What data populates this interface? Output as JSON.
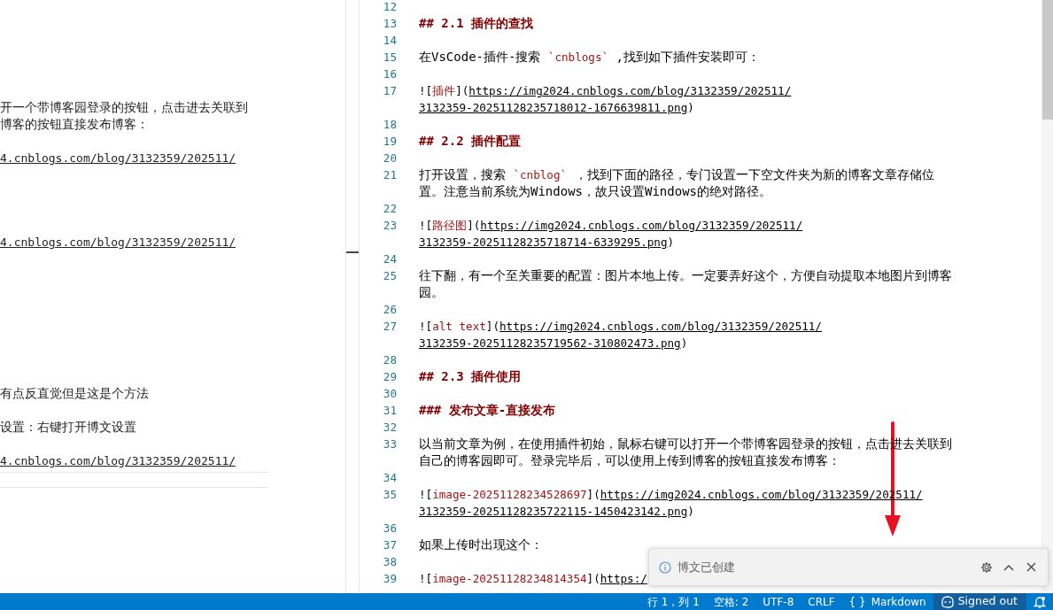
{
  "preview": {
    "blocks": [
      {
        "kind": "text",
        "lines": [
          "开一个带博客园登录的按钮，点击进去关联到",
          "博客的按钮直接发布博客："
        ]
      },
      {
        "kind": "link",
        "lines": [
          "4.cnblogs.com/blog/3132359/202511/"
        ]
      },
      {
        "kind": "link",
        "lines": [
          "4.cnblogs.com/blog/3132359/202511/"
        ]
      },
      {
        "kind": "text",
        "lines": [
          "有点反直觉但是这是个方法"
        ]
      },
      {
        "kind": "text",
        "lines": [
          "设置：右键打开博文设置"
        ]
      },
      {
        "kind": "link",
        "lines": [
          "4.cnblogs.com/blog/3132359/202511/"
        ]
      }
    ]
  },
  "editor": {
    "lines": [
      {
        "number": "12"
      },
      {
        "number": "13",
        "parts": [
          {
            "kind": "heading",
            "text": "## 2.1 插件的查找"
          }
        ]
      },
      {
        "number": "14"
      },
      {
        "number": "15",
        "parts": [
          {
            "kind": "text",
            "text": "在VsCode-插件-搜索 "
          },
          {
            "kind": "code",
            "text": "`cnblogs`"
          },
          {
            "kind": "text",
            "text": " ,找到如下插件安装即可："
          }
        ]
      },
      {
        "number": "16"
      },
      {
        "number": "17",
        "parts": [
          {
            "kind": "punct",
            "text": "!["
          },
          {
            "kind": "alt",
            "text": "插件"
          },
          {
            "kind": "punct",
            "text": "]("
          },
          {
            "kind": "url",
            "text": "https://img2024.cnblogs.com/blog/3132359/202511/"
          }
        ]
      },
      {
        "parts": [
          {
            "kind": "url",
            "text": "3132359-20251128235718012-1676639811.png"
          },
          {
            "kind": "punct",
            "text": ")"
          }
        ]
      },
      {
        "number": "18"
      },
      {
        "number": "19",
        "parts": [
          {
            "kind": "heading",
            "text": "## 2.2 插件配置"
          }
        ]
      },
      {
        "number": "20"
      },
      {
        "number": "21",
        "parts": [
          {
            "kind": "text",
            "text": "打开设置，搜索 "
          },
          {
            "kind": "code",
            "text": "`cnblog`"
          },
          {
            "kind": "text",
            "text": " ，找到下面的路径，专门设置一下空文件夹为新的博客文章存储位"
          }
        ]
      },
      {
        "parts": [
          {
            "kind": "text",
            "text": "置。注意当前系统为Windows，故只设置Windows的绝对路径。"
          }
        ]
      },
      {
        "number": "22"
      },
      {
        "number": "23",
        "parts": [
          {
            "kind": "punct",
            "text": "!["
          },
          {
            "kind": "alt",
            "text": "路径图"
          },
          {
            "kind": "punct",
            "text": "]("
          },
          {
            "kind": "url",
            "text": "https://img2024.cnblogs.com/blog/3132359/202511/"
          }
        ]
      },
      {
        "parts": [
          {
            "kind": "url",
            "text": "3132359-20251128235718714-6339295.png"
          },
          {
            "kind": "punct",
            "text": ")"
          }
        ]
      },
      {
        "number": "24"
      },
      {
        "number": "25",
        "parts": [
          {
            "kind": "text",
            "text": "往下翻，有一个至关重要的配置：图片本地上传。一定要弄好这个，方便自动提取本地图片到博客"
          }
        ]
      },
      {
        "parts": [
          {
            "kind": "text",
            "text": "园。"
          }
        ]
      },
      {
        "number": "26"
      },
      {
        "number": "27",
        "parts": [
          {
            "kind": "punct",
            "text": "!["
          },
          {
            "kind": "alt",
            "text": "alt text"
          },
          {
            "kind": "punct",
            "text": "]("
          },
          {
            "kind": "url",
            "text": "https://img2024.cnblogs.com/blog/3132359/202511/"
          }
        ]
      },
      {
        "parts": [
          {
            "kind": "url",
            "text": "3132359-20251128235719562-310802473.png"
          },
          {
            "kind": "punct",
            "text": ")"
          }
        ]
      },
      {
        "number": "28"
      },
      {
        "number": "29",
        "parts": [
          {
            "kind": "heading",
            "text": "## 2.3 插件使用"
          }
        ]
      },
      {
        "number": "30"
      },
      {
        "number": "31",
        "parts": [
          {
            "kind": "heading",
            "text": "### 发布文章-直接发布"
          }
        ]
      },
      {
        "number": "32"
      },
      {
        "number": "33",
        "parts": [
          {
            "kind": "text",
            "text": "以当前文章为例，在使用插件初始，鼠标右键可以打开一个带博客园登录的按钮，点击进去关联到"
          }
        ]
      },
      {
        "parts": [
          {
            "kind": "text",
            "text": "自己的博客园即可。登录完毕后，可以使用上传到博客的按钮直接发布博客："
          }
        ]
      },
      {
        "number": "34"
      },
      {
        "number": "35",
        "parts": [
          {
            "kind": "punct",
            "text": "!["
          },
          {
            "kind": "alt",
            "text": "image-20251128234528697"
          },
          {
            "kind": "punct",
            "text": "]("
          },
          {
            "kind": "url",
            "text": "https://img2024.cnblogs.com/blog/3132359/202511/"
          }
        ]
      },
      {
        "parts": [
          {
            "kind": "url",
            "text": "3132359-20251128235722115-1450423142.png"
          },
          {
            "kind": "punct",
            "text": ")"
          }
        ]
      },
      {
        "number": "36"
      },
      {
        "number": "37",
        "parts": [
          {
            "kind": "text",
            "text": "如果上传时出现这个："
          }
        ]
      },
      {
        "number": "38"
      },
      {
        "number": "39",
        "parts": [
          {
            "kind": "punct",
            "text": "!["
          },
          {
            "kind": "alt",
            "text": "image-20251128234814354"
          },
          {
            "kind": "punct",
            "text": "]("
          },
          {
            "kind": "url",
            "text": "https:/"
          }
        ]
      }
    ]
  },
  "notification": {
    "message": "博文已创建"
  },
  "status_bar": {
    "items": [
      {
        "text": "行 1，列 1"
      },
      {
        "text": "空格: 2"
      },
      {
        "text": "UTF-8"
      },
      {
        "text": "CRLF"
      },
      {
        "text": "{ }"
      },
      {
        "text": "Markdown"
      }
    ],
    "account": "Signed out"
  }
}
